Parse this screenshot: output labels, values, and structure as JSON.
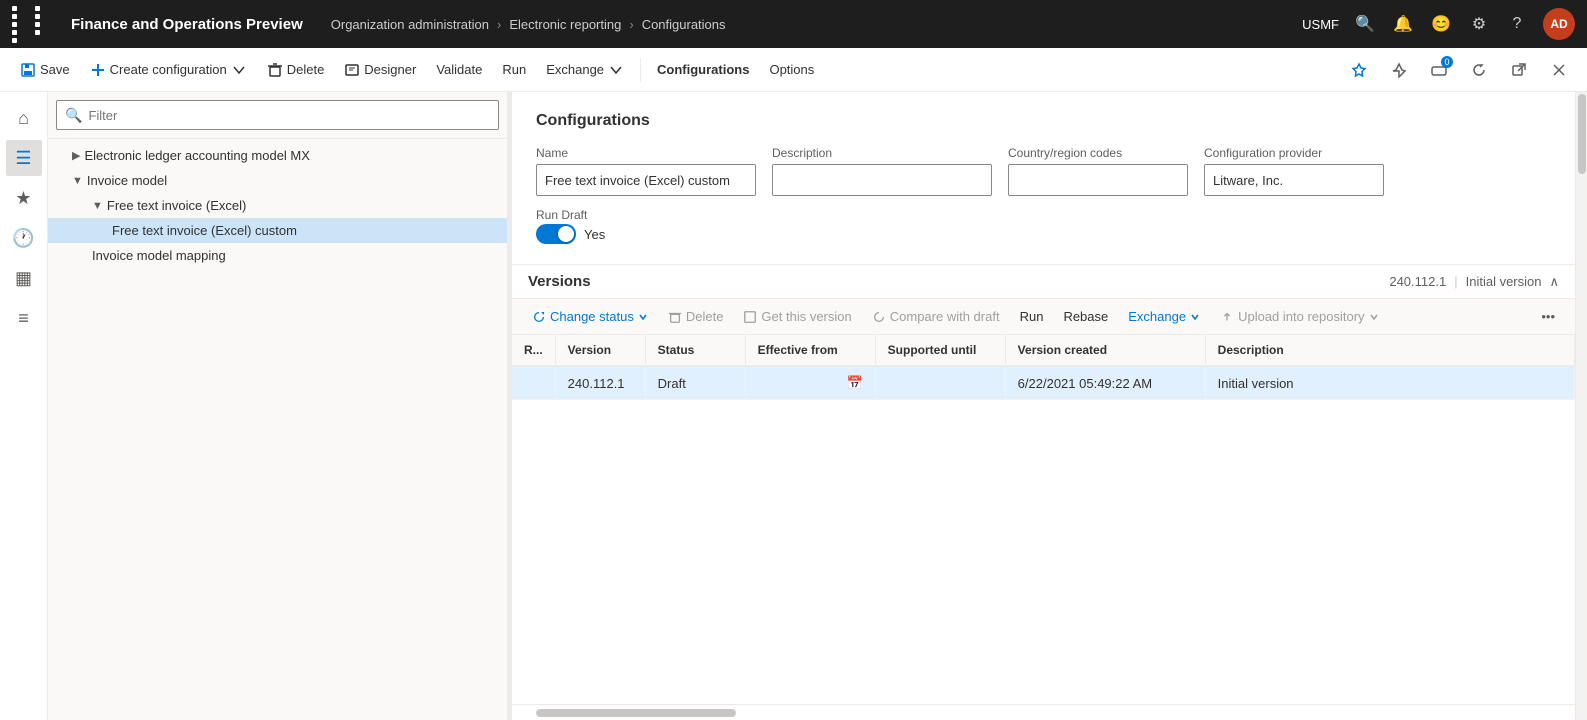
{
  "topbar": {
    "title": "Finance and Operations Preview",
    "breadcrumb": [
      "Organization administration",
      "Electronic reporting",
      "Configurations"
    ],
    "org": "USMF",
    "avatar_initials": "AD"
  },
  "toolbar": {
    "save": "Save",
    "create_config": "Create configuration",
    "delete": "Delete",
    "designer": "Designer",
    "validate": "Validate",
    "run": "Run",
    "exchange": "Exchange",
    "configurations": "Configurations",
    "options": "Options"
  },
  "filter": {
    "placeholder": "Filter"
  },
  "tree": {
    "items": [
      {
        "label": "Electronic ledger accounting model MX",
        "indent": 1,
        "expanded": false,
        "type": "folder"
      },
      {
        "label": "Invoice model",
        "indent": 1,
        "expanded": true,
        "type": "folder"
      },
      {
        "label": "Free text invoice (Excel)",
        "indent": 2,
        "expanded": true,
        "type": "folder"
      },
      {
        "label": "Free text invoice (Excel) custom",
        "indent": 3,
        "expanded": false,
        "type": "file",
        "selected": true
      },
      {
        "label": "Invoice model mapping",
        "indent": 2,
        "expanded": false,
        "type": "file"
      }
    ]
  },
  "config_panel": {
    "title": "Configurations",
    "name_label": "Name",
    "name_value": "Free text invoice (Excel) custom",
    "description_label": "Description",
    "description_value": "",
    "country_label": "Country/region codes",
    "country_value": "",
    "provider_label": "Configuration provider",
    "provider_value": "Litware, Inc.",
    "run_draft_label": "Run Draft",
    "run_draft_value": "Yes"
  },
  "versions": {
    "title": "Versions",
    "version_number": "240.112.1",
    "version_label": "Initial version",
    "toolbar": {
      "change_status": "Change status",
      "delete": "Delete",
      "get_this_version": "Get this version",
      "compare_with_draft": "Compare with draft",
      "run": "Run",
      "rebase": "Rebase",
      "exchange": "Exchange",
      "upload_into_repository": "Upload into repository"
    },
    "table": {
      "columns": [
        "R...",
        "Version",
        "Status",
        "Effective from",
        "Supported until",
        "Version created",
        "Description"
      ],
      "rows": [
        {
          "r": "",
          "version": "240.112.1",
          "status": "Draft",
          "effective_from": "",
          "supported_until": "",
          "version_created": "6/22/2021 05:49:22 AM",
          "description": "Initial version",
          "selected": true
        }
      ]
    }
  }
}
